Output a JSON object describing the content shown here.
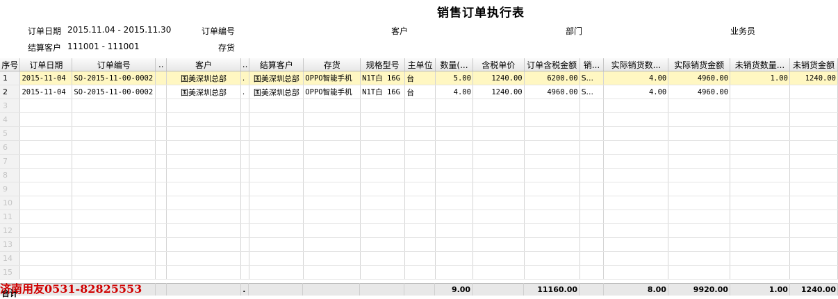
{
  "title": "销售订单执行表",
  "filters": {
    "order_date_label": "订单日期",
    "order_date_value": "2015.11.04 - 2015.11.30",
    "order_no_label": "订单编号",
    "customer_label": "客户",
    "dept_label": "部门",
    "salesman_label": "业务员",
    "settle_customer_label": "结算客户",
    "settle_customer_value": "111001 - 111001",
    "stock_label": "存货"
  },
  "columns": [
    "序号",
    "订单日期",
    "订单编号",
    "..",
    "客户",
    "..",
    "结算客户",
    "存货",
    "规格型号",
    "主单位",
    "数量(...",
    "含税单价",
    "订单含税金额",
    "销...",
    "实际销货数...",
    "实际销货金额",
    "未销货数量...",
    "未销货金额"
  ],
  "rows": [
    [
      "1",
      "2015-11-04",
      "SO-2015-11-00-0002",
      "",
      "国美深圳总部",
      ".",
      "国美深圳总部",
      "OPPO智能手机",
      "N1T白 16G",
      "台",
      "5.00",
      "1240.00",
      "6200.00",
      "S...",
      "4.00",
      "4960.00",
      "1.00",
      "1240.00"
    ],
    [
      "2",
      "2015-11-04",
      "SO-2015-11-00-0002",
      "",
      "国美深圳总部",
      ".",
      "国美深圳总部",
      "OPPO智能手机",
      "N1T白 16G",
      "台",
      "4.00",
      "1240.00",
      "4960.00",
      "S...",
      "4.00",
      "4960.00",
      "",
      ""
    ]
  ],
  "empty_row_numbers": [
    "3",
    "4",
    "5",
    "6",
    "7",
    "8",
    "9",
    "10",
    "11",
    "12",
    "13",
    "14",
    "15"
  ],
  "totals": {
    "label": "合计",
    "col5": ".",
    "quantity": "9.00",
    "order_amount": "11160.00",
    "actual_qty": "8.00",
    "actual_amount": "9920.00",
    "unsold_qty": "1.00",
    "unsold_amount": "1240.00"
  },
  "watermark": "济南用友0531-82825553"
}
